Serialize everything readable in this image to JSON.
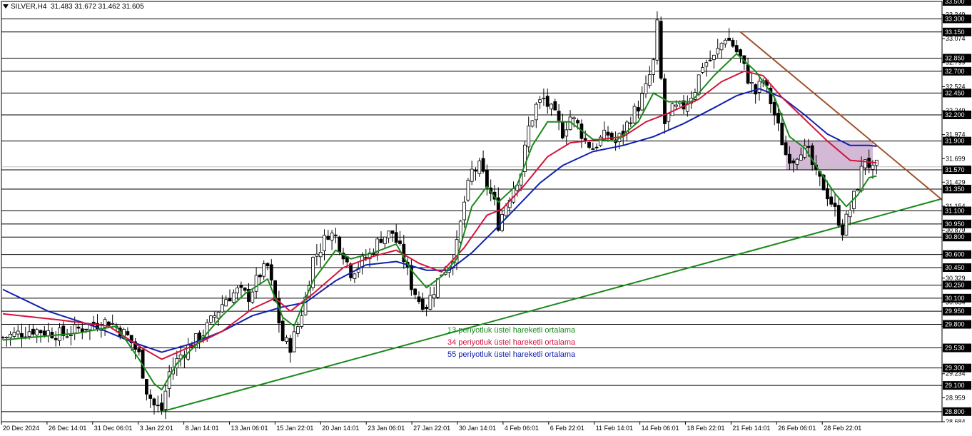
{
  "header": {
    "symbol": "SILVER,H4",
    "ohlc": "31.483 31.672 31.462 31.605"
  },
  "legend": [
    {
      "label": "13 periyotluk üstel hareketli ortalama",
      "color": "#1a8a1a"
    },
    {
      "label": "34 periyotluk üstel hareketli ortalama",
      "color": "#d4143c"
    },
    {
      "label": "55 periyotluk üstel hareketli ortalama",
      "color": "#1020b0"
    }
  ],
  "chart_data": {
    "type": "candlestick",
    "ylim": [
      28.684,
      33.5
    ],
    "x_tick_labels": [
      "20 Dec 2024",
      "26 Dec 14:01",
      "31 Dec 06:01",
      "3 Jan 22:01",
      "8 Jan 14:01",
      "13 Jan 06:01",
      "15 Jan 22:01",
      "20 Jan 14:01",
      "23 Jan 06:01",
      "27 Jan 22:01",
      "30 Jan 14:01",
      "4 Feb 06:01",
      "6 Feb 22:01",
      "11 Feb 14:01",
      "14 Feb 06:01",
      "18 Feb 22:01",
      "21 Feb 14:01",
      "26 Feb 06:01",
      "28 Feb 22:01"
    ],
    "y_tick_labels": [
      "33.349",
      "33.074",
      "32.799",
      "32.524",
      "32.249",
      "31.974",
      "31.699",
      "31.429",
      "31.154",
      "30.879",
      "30.604",
      "30.329",
      "30.054",
      "29.779",
      "29.504",
      "29.234",
      "28.959",
      "28.684"
    ],
    "horizontal_levels": [
      33.5,
      33.3,
      33.15,
      32.85,
      32.7,
      32.45,
      32.2,
      31.9,
      31.57,
      31.35,
      31.1,
      30.95,
      30.8,
      30.6,
      30.45,
      30.25,
      30.1,
      29.95,
      29.8,
      29.53,
      29.3,
      29.1,
      28.8
    ],
    "current_price": 31.605,
    "close_path": [
      [
        0,
        29.65
      ],
      [
        8,
        29.74
      ],
      [
        16,
        29.68
      ],
      [
        22,
        29.78
      ],
      [
        28,
        29.84
      ],
      [
        33,
        29.66
      ],
      [
        36,
        29.45
      ],
      [
        38,
        29.05
      ],
      [
        40,
        28.87
      ],
      [
        42,
        28.82
      ],
      [
        44,
        29.25
      ],
      [
        47,
        29.45
      ],
      [
        50,
        29.58
      ],
      [
        53,
        29.7
      ],
      [
        56,
        29.9
      ],
      [
        59,
        30.1
      ],
      [
        62,
        30.18
      ],
      [
        65,
        30.12
      ],
      [
        68,
        30.38
      ],
      [
        70,
        30.46
      ],
      [
        72,
        30.05
      ],
      [
        74,
        29.62
      ],
      [
        76,
        29.55
      ],
      [
        78,
        29.78
      ],
      [
        80,
        30.1
      ],
      [
        82,
        30.55
      ],
      [
        84,
        30.68
      ],
      [
        86,
        30.85
      ],
      [
        88,
        30.8
      ],
      [
        90,
        30.62
      ],
      [
        92,
        30.4
      ],
      [
        94,
        30.48
      ],
      [
        97,
        30.6
      ],
      [
        100,
        30.8
      ],
      [
        103,
        30.85
      ],
      [
        106,
        30.55
      ],
      [
        108,
        30.25
      ],
      [
        110,
        30.08
      ],
      [
        112,
        30.02
      ],
      [
        114,
        30.2
      ],
      [
        116,
        30.4
      ],
      [
        118,
        30.48
      ],
      [
        120,
        30.7
      ],
      [
        122,
        31.2
      ],
      [
        124,
        31.55
      ],
      [
        126,
        31.6
      ],
      [
        128,
        31.4
      ],
      [
        130,
        31.18
      ],
      [
        131,
        30.95
      ],
      [
        133,
        31.18
      ],
      [
        135,
        31.38
      ],
      [
        137,
        31.55
      ],
      [
        139,
        32.05
      ],
      [
        141,
        32.3
      ],
      [
        143,
        32.38
      ],
      [
        146,
        32.18
      ],
      [
        148,
        32.0
      ],
      [
        150,
        32.18
      ],
      [
        152,
        32.08
      ],
      [
        154,
        31.9
      ],
      [
        156,
        31.82
      ],
      [
        158,
        31.92
      ],
      [
        160,
        31.98
      ],
      [
        162,
        31.88
      ],
      [
        164,
        32.0
      ],
      [
        166,
        32.18
      ],
      [
        168,
        32.3
      ],
      [
        170,
        32.5
      ],
      [
        172,
        32.8
      ],
      [
        173,
        33.22
      ],
      [
        174,
        32.6
      ],
      [
        175,
        32.1
      ],
      [
        177,
        32.25
      ],
      [
        180,
        32.3
      ],
      [
        183,
        32.5
      ],
      [
        185,
        32.78
      ],
      [
        188,
        32.85
      ],
      [
        191,
        33.1
      ],
      [
        193,
        33.0
      ],
      [
        195,
        32.85
      ],
      [
        197,
        32.62
      ],
      [
        199,
        32.45
      ],
      [
        201,
        32.6
      ],
      [
        203,
        32.35
      ],
      [
        205,
        32.05
      ],
      [
        207,
        31.75
      ],
      [
        209,
        31.7
      ],
      [
        211,
        31.82
      ],
      [
        213,
        31.75
      ],
      [
        215,
        31.5
      ],
      [
        217,
        31.38
      ],
      [
        219,
        31.2
      ],
      [
        221,
        31.0
      ],
      [
        222,
        30.88
      ],
      [
        224,
        31.12
      ],
      [
        226,
        31.4
      ],
      [
        228,
        31.72
      ],
      [
        230,
        31.55
      ],
      [
        231,
        31.605
      ]
    ],
    "ema13": [
      [
        0,
        29.62
      ],
      [
        20,
        29.7
      ],
      [
        30,
        29.78
      ],
      [
        36,
        29.4
      ],
      [
        40,
        29.12
      ],
      [
        42,
        29.05
      ],
      [
        46,
        29.35
      ],
      [
        52,
        29.6
      ],
      [
        58,
        29.9
      ],
      [
        64,
        30.15
      ],
      [
        70,
        30.32
      ],
      [
        74,
        29.88
      ],
      [
        77,
        29.78
      ],
      [
        82,
        30.3
      ],
      [
        88,
        30.65
      ],
      [
        92,
        30.55
      ],
      [
        98,
        30.62
      ],
      [
        104,
        30.72
      ],
      [
        108,
        30.42
      ],
      [
        112,
        30.22
      ],
      [
        116,
        30.35
      ],
      [
        120,
        30.55
      ],
      [
        124,
        31.15
      ],
      [
        128,
        31.38
      ],
      [
        131,
        31.2
      ],
      [
        136,
        31.4
      ],
      [
        140,
        31.85
      ],
      [
        144,
        32.12
      ],
      [
        150,
        32.12
      ],
      [
        156,
        31.92
      ],
      [
        162,
        31.9
      ],
      [
        168,
        32.12
      ],
      [
        172,
        32.45
      ],
      [
        176,
        32.35
      ],
      [
        182,
        32.35
      ],
      [
        188,
        32.65
      ],
      [
        194,
        32.9
      ],
      [
        199,
        32.7
      ],
      [
        204,
        32.4
      ],
      [
        208,
        31.95
      ],
      [
        212,
        31.82
      ],
      [
        216,
        31.55
      ],
      [
        220,
        31.3
      ],
      [
        223,
        31.15
      ],
      [
        226,
        31.28
      ],
      [
        229,
        31.48
      ],
      [
        231,
        31.5
      ]
    ],
    "ema34": [
      [
        0,
        29.92
      ],
      [
        15,
        29.85
      ],
      [
        28,
        29.78
      ],
      [
        36,
        29.55
      ],
      [
        42,
        29.4
      ],
      [
        50,
        29.55
      ],
      [
        58,
        29.72
      ],
      [
        66,
        29.98
      ],
      [
        72,
        30.1
      ],
      [
        76,
        29.95
      ],
      [
        82,
        30.15
      ],
      [
        90,
        30.45
      ],
      [
        98,
        30.58
      ],
      [
        104,
        30.65
      ],
      [
        110,
        30.5
      ],
      [
        116,
        30.4
      ],
      [
        122,
        30.68
      ],
      [
        128,
        31.05
      ],
      [
        132,
        31.12
      ],
      [
        138,
        31.4
      ],
      [
        144,
        31.72
      ],
      [
        150,
        31.88
      ],
      [
        158,
        31.92
      ],
      [
        164,
        31.95
      ],
      [
        170,
        32.12
      ],
      [
        176,
        32.22
      ],
      [
        184,
        32.38
      ],
      [
        190,
        32.58
      ],
      [
        196,
        32.7
      ],
      [
        201,
        32.65
      ],
      [
        206,
        32.4
      ],
      [
        212,
        32.15
      ],
      [
        218,
        31.9
      ],
      [
        224,
        31.68
      ],
      [
        229,
        31.66
      ],
      [
        231,
        31.65
      ]
    ],
    "ema55": [
      [
        0,
        30.2
      ],
      [
        12,
        29.95
      ],
      [
        24,
        29.78
      ],
      [
        34,
        29.6
      ],
      [
        42,
        29.48
      ],
      [
        50,
        29.58
      ],
      [
        58,
        29.72
      ],
      [
        66,
        29.9
      ],
      [
        74,
        30.0
      ],
      [
        80,
        30.05
      ],
      [
        88,
        30.3
      ],
      [
        96,
        30.48
      ],
      [
        104,
        30.52
      ],
      [
        112,
        30.42
      ],
      [
        118,
        30.42
      ],
      [
        124,
        30.62
      ],
      [
        130,
        30.88
      ],
      [
        136,
        31.15
      ],
      [
        142,
        31.42
      ],
      [
        148,
        31.62
      ],
      [
        156,
        31.78
      ],
      [
        164,
        31.85
      ],
      [
        172,
        31.95
      ],
      [
        180,
        32.1
      ],
      [
        188,
        32.28
      ],
      [
        194,
        32.42
      ],
      [
        200,
        32.5
      ],
      [
        206,
        32.4
      ],
      [
        212,
        32.2
      ],
      [
        218,
        31.98
      ],
      [
        224,
        31.85
      ],
      [
        229,
        31.85
      ],
      [
        231,
        31.84
      ]
    ],
    "support_trendline": [
      [
        42,
        28.8
      ],
      [
        256,
        31.33
      ]
    ],
    "resistance_trendline": [
      [
        195,
        33.15
      ],
      [
        256,
        30.95
      ]
    ],
    "resistance_zone": {
      "from_bar": 207,
      "to_bar": 230,
      "low": 31.57,
      "high": 31.9
    }
  },
  "colors": {
    "up_candle": "#ffffff",
    "down_candle": "#000000",
    "candle_outline": "#000000",
    "level_line": "#000000",
    "support_line": "#1a8a1a",
    "resistance_line": "#a0522d",
    "zone_fill": "#c8a8cc",
    "ema13": "#1a8a1a",
    "ema34": "#d4143c",
    "ema55": "#1020b0"
  }
}
